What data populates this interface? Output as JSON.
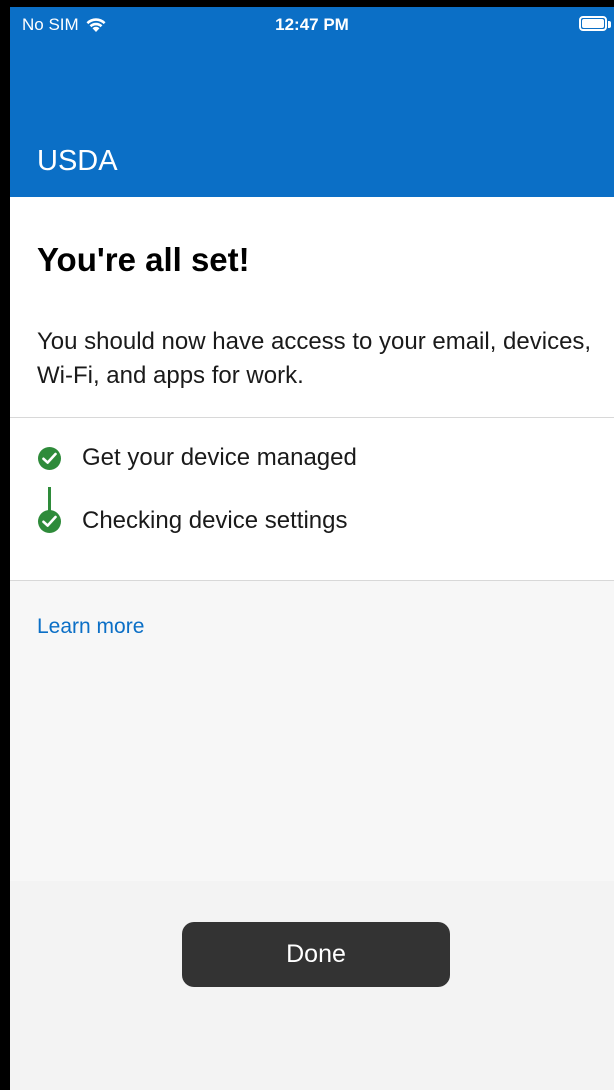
{
  "status_bar": {
    "carrier": "No SIM",
    "time": "12:47 PM"
  },
  "header": {
    "org_name": "USDA",
    "background_color": "#0b6fc6"
  },
  "main": {
    "heading": "You're all set!",
    "description": "You should now have access to your email, devices, Wi-Fi, and apps for work.",
    "steps": [
      {
        "label": "Get your device managed",
        "status": "complete",
        "icon": "check-circle-icon"
      },
      {
        "label": "Checking device settings",
        "status": "complete",
        "icon": "check-circle-icon"
      }
    ],
    "learn_more_label": "Learn more"
  },
  "footer": {
    "done_label": "Done"
  },
  "colors": {
    "accent": "#0b6fc6",
    "success": "#2e8b3a",
    "button": "#333333"
  }
}
